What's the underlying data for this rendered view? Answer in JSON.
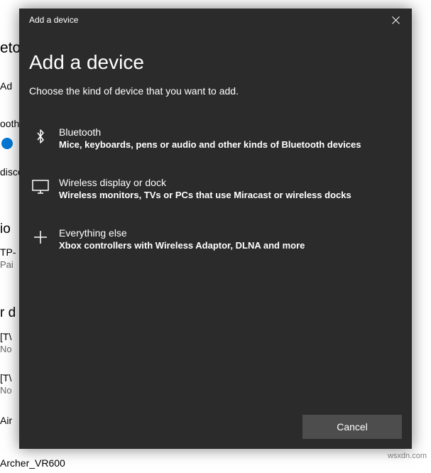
{
  "background": {
    "settings_fragment_1": "eto",
    "add_prefix": "Ad",
    "bluetooth_fragment": "ooth",
    "discoverable_fragment": "disco",
    "audio_fragment": "io",
    "device_tp": "TP-",
    "paired_fragment": "Pai",
    "other_fragment": "r d",
    "tv1": "[T\\",
    "tv1_status": "No",
    "tv2": "[T\\",
    "tv2_status": "No",
    "air_fragment": "Air",
    "router": "Archer_VR600"
  },
  "dialog": {
    "titlebar": "Add a device",
    "heading": "Add a device",
    "subtitle": "Choose the kind of device that you want to add.",
    "options": [
      {
        "title": "Bluetooth",
        "description": "Mice, keyboards, pens or audio and other kinds of Bluetooth devices"
      },
      {
        "title": "Wireless display or dock",
        "description": "Wireless monitors, TVs or PCs that use Miracast or wireless docks"
      },
      {
        "title": "Everything else",
        "description": "Xbox controllers with Wireless Adaptor, DLNA and more"
      }
    ],
    "cancel": "Cancel"
  },
  "watermark": "wsxdn.com"
}
